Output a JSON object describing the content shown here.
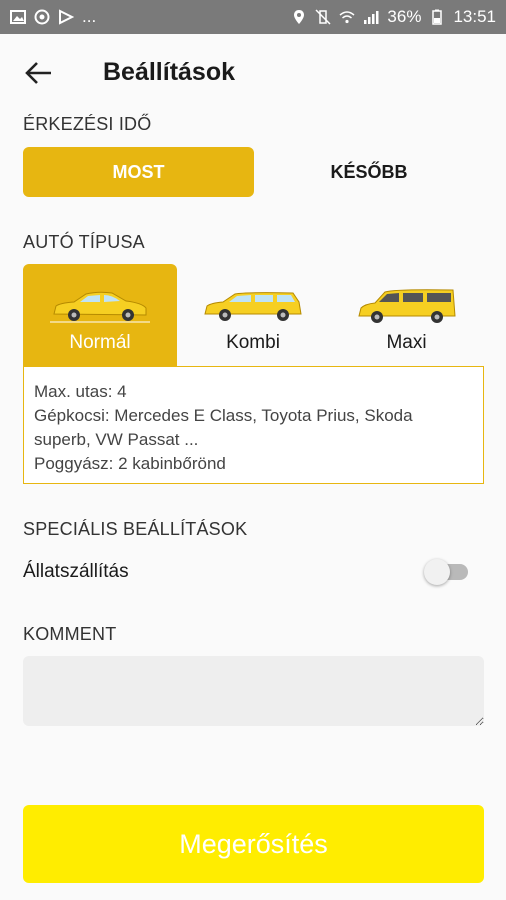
{
  "status_bar": {
    "overflow": "...",
    "battery": "36%",
    "time": "13:51"
  },
  "header": {
    "title": "Beállítások"
  },
  "arrival": {
    "label": "ÉRKEZÉSI IDŐ",
    "now_label": "MOST",
    "later_label": "KÉSŐBB"
  },
  "car_type": {
    "label": "AUTÓ TÍPUSA",
    "options": [
      {
        "label": "Normál",
        "selected": true
      },
      {
        "label": "Kombi",
        "selected": false
      },
      {
        "label": "Maxi",
        "selected": false
      }
    ],
    "info_lines": [
      "Max. utas: 4",
      "Gépkocsi: Mercedes E Class, Toyota Prius, Skoda",
      "superb, VW Passat ...",
      "Poggyász: 2 kabinbőrönd"
    ]
  },
  "special": {
    "label": "SPECIÁLIS BEÁLLÍTÁSOK",
    "pet_transport_label": "Állatszállítás",
    "pet_transport_on": false
  },
  "comment": {
    "label": "KOMMENT",
    "value": "",
    "placeholder": ""
  },
  "confirm_label": "Megerősítés",
  "colors": {
    "accent": "#e7b611",
    "confirm": "#ffed00",
    "status_bar": "#7a7a7a"
  }
}
